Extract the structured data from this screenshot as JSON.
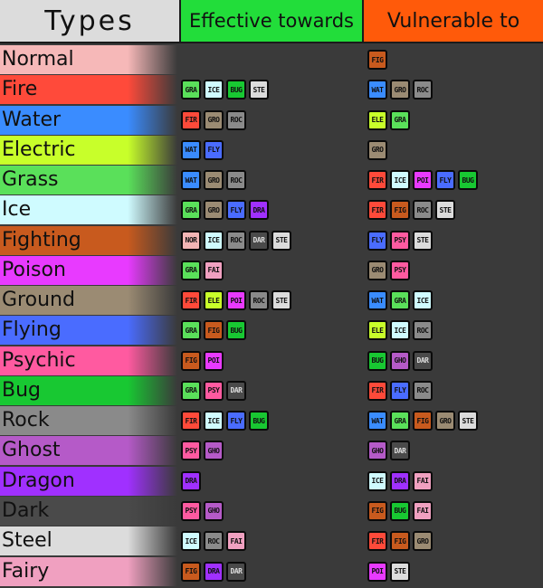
{
  "headers": {
    "types": "Types",
    "effective": "Effective towards",
    "vulnerable": "Vulnerable to"
  },
  "colors": {
    "NOR": "#f2b5b5",
    "FIR": "#ff4a3a",
    "WAT": "#3a8cff",
    "ELE": "#c8ff2a",
    "GRA": "#5ae05a",
    "ICE": "#cffbff",
    "FIG": "#c85a1e",
    "POI": "#e83aff",
    "GRO": "#9b8b73",
    "FLY": "#4a6cff",
    "PSY": "#ff5aa0",
    "BUG": "#18c832",
    "ROC": "#8a8a8a",
    "GHO": "#b55ac8",
    "DRA": "#a030ff",
    "DAR": "#4a4a4a",
    "STE": "#dcdcdc",
    "FAI": "#f0a0c0"
  },
  "rows": [
    {
      "name": "Normal",
      "color": "#f6b8b8",
      "effective": [],
      "vulnerable": [
        "FIG"
      ]
    },
    {
      "name": "Fire",
      "color": "#ff4a3a",
      "effective": [
        "GRA",
        "ICE",
        "BUG",
        "STE"
      ],
      "vulnerable": [
        "WAT",
        "GRO",
        "ROC"
      ]
    },
    {
      "name": "Water",
      "color": "#3a8cff",
      "effective": [
        "FIR",
        "GRO",
        "ROC"
      ],
      "vulnerable": [
        "ELE",
        "GRA"
      ]
    },
    {
      "name": "Electric",
      "color": "#c8ff2a",
      "effective": [
        "WAT",
        "FLY"
      ],
      "vulnerable": [
        "GRO"
      ]
    },
    {
      "name": "Grass",
      "color": "#5ae05a",
      "effective": [
        "WAT",
        "GRO",
        "ROC"
      ],
      "vulnerable": [
        "FIR",
        "ICE",
        "POI",
        "FLY",
        "BUG"
      ]
    },
    {
      "name": "Ice",
      "color": "#cffbff",
      "effective": [
        "GRA",
        "GRO",
        "FLY",
        "DRA"
      ],
      "vulnerable": [
        "FIR",
        "FIG",
        "ROC",
        "STE"
      ]
    },
    {
      "name": "Fighting",
      "color": "#c85a1e",
      "effective": [
        "NOR",
        "ICE",
        "ROC",
        "DAR",
        "STE"
      ],
      "vulnerable": [
        "FLY",
        "PSY",
        "STE"
      ]
    },
    {
      "name": "Poison",
      "color": "#e83aff",
      "effective": [
        "GRA",
        "FAI"
      ],
      "vulnerable": [
        "GRO",
        "PSY"
      ]
    },
    {
      "name": "Ground",
      "color": "#9b8b73",
      "effective": [
        "FIR",
        "ELE",
        "POI",
        "ROC",
        "STE"
      ],
      "vulnerable": [
        "WAT",
        "GRA",
        "ICE"
      ]
    },
    {
      "name": "Flying",
      "color": "#4a6cff",
      "effective": [
        "GRA",
        "FIG",
        "BUG"
      ],
      "vulnerable": [
        "ELE",
        "ICE",
        "ROC"
      ]
    },
    {
      "name": "Psychic",
      "color": "#ff5aa0",
      "effective": [
        "FIG",
        "POI"
      ],
      "vulnerable": [
        "BUG",
        "GHO",
        "DAR"
      ]
    },
    {
      "name": "Bug",
      "color": "#18c832",
      "effective": [
        "GRA",
        "PSY",
        "DAR"
      ],
      "vulnerable": [
        "FIR",
        "FLY",
        "ROC"
      ]
    },
    {
      "name": "Rock",
      "color": "#8a8a8a",
      "effective": [
        "FIR",
        "ICE",
        "FLY",
        "BUG"
      ],
      "vulnerable": [
        "WAT",
        "GRA",
        "FIG",
        "GRO",
        "STE"
      ]
    },
    {
      "name": "Ghost",
      "color": "#b55ac8",
      "effective": [
        "PSY",
        "GHO"
      ],
      "vulnerable": [
        "GHO",
        "DAR"
      ]
    },
    {
      "name": "Dragon",
      "color": "#a030ff",
      "effective": [
        "DRA"
      ],
      "vulnerable": [
        "ICE",
        "DRA",
        "FAI"
      ]
    },
    {
      "name": "Dark",
      "color": "#4a4a4a",
      "effective": [
        "PSY",
        "GHO"
      ],
      "vulnerable": [
        "FIG",
        "BUG",
        "FAI"
      ]
    },
    {
      "name": "Steel",
      "color": "#dcdcdc",
      "effective": [
        "ICE",
        "ROC",
        "FAI"
      ],
      "vulnerable": [
        "FIR",
        "FIG",
        "GRO"
      ]
    },
    {
      "name": "Fairy",
      "color": "#f0a0c0",
      "effective": [
        "FIG",
        "DRA",
        "DAR"
      ],
      "vulnerable": [
        "POI",
        "STE"
      ]
    }
  ]
}
